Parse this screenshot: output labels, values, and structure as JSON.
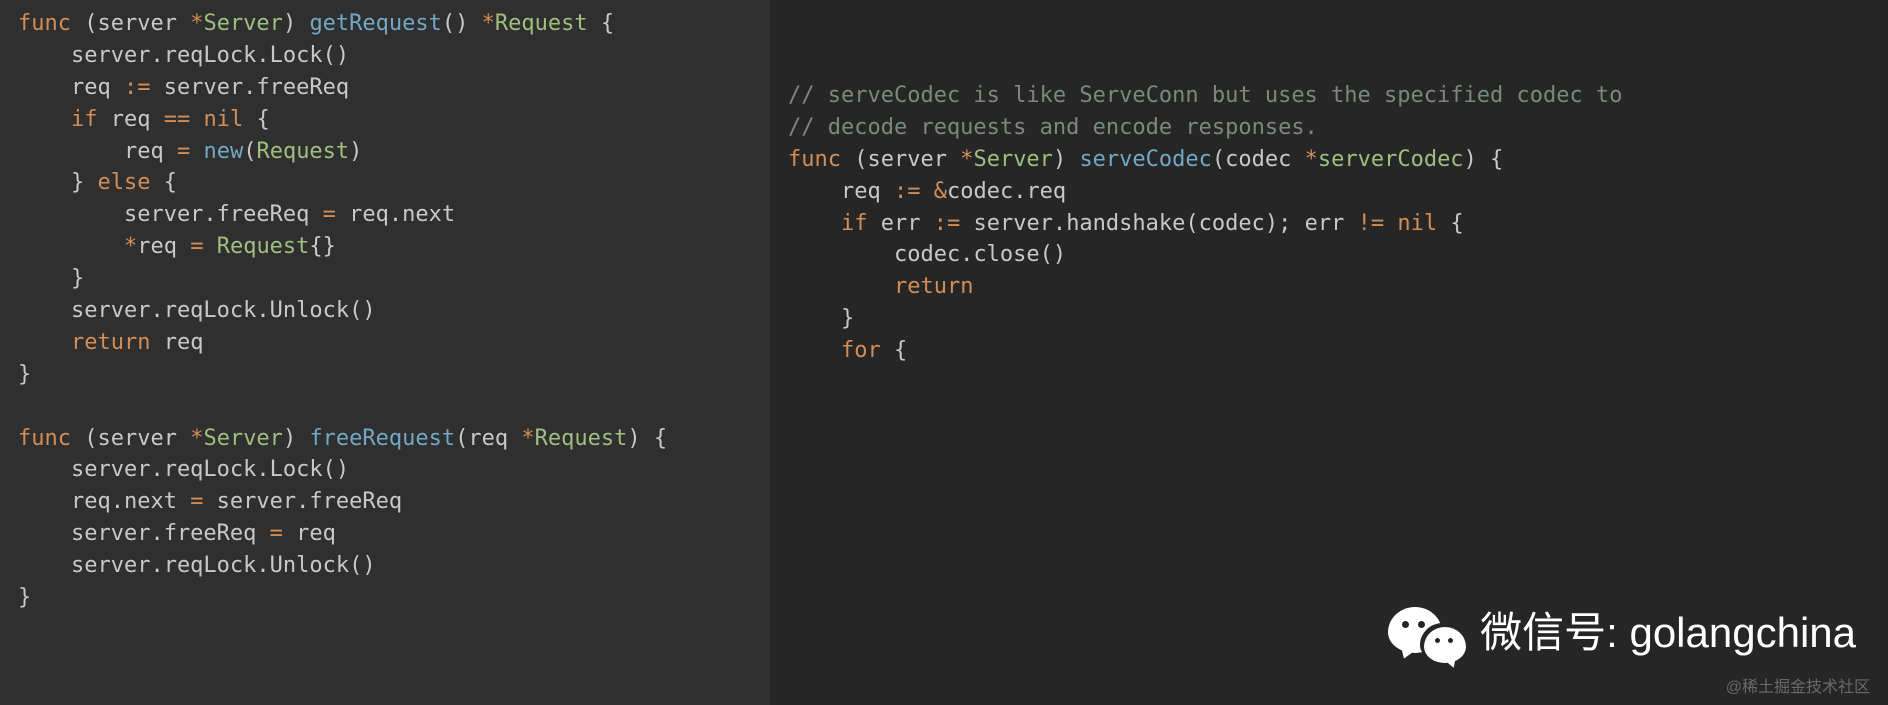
{
  "left": {
    "l1a": "func",
    "l1b": " (server ",
    "l1c": "*",
    "l1d": "Server",
    "l1e": ") ",
    "l1f": "getRequest",
    "l1g": "() ",
    "l1h": "*",
    "l1i": "Request",
    "l1j": " {",
    "l2a": "    server.reqLock.",
    "l2b": "Lock",
    "l2c": "()",
    "l3a": "    req ",
    "l3b": ":=",
    "l3c": " server.freeReq",
    "l4a": "    ",
    "l4b": "if",
    "l4c": " req ",
    "l4d": "==",
    "l4e": " ",
    "l4f": "nil",
    "l4g": " {",
    "l5a": "        req ",
    "l5b": "=",
    "l5c": " ",
    "l5d": "new",
    "l5e": "(",
    "l5f": "Request",
    "l5g": ")",
    "l6a": "    } ",
    "l6b": "else",
    "l6c": " {",
    "l7a": "        server.freeReq ",
    "l7b": "=",
    "l7c": " req.next",
    "l8a": "        ",
    "l8b": "*",
    "l8c": "req ",
    "l8d": "=",
    "l8e": " ",
    "l8f": "Request",
    "l8g": "{}",
    "l9a": "    }",
    "l10a": "    server.reqLock.",
    "l10b": "Unlock",
    "l10c": "()",
    "l11a": "    ",
    "l11b": "return",
    "l11c": " req",
    "l12a": "}",
    "blank": "",
    "l14a": "func",
    "l14b": " (server ",
    "l14c": "*",
    "l14d": "Server",
    "l14e": ") ",
    "l14f": "freeRequest",
    "l14g": "(req ",
    "l14h": "*",
    "l14i": "Request",
    "l14j": ") {",
    "l15a": "    server.reqLock.",
    "l15b": "Lock",
    "l15c": "()",
    "l16a": "    req.next ",
    "l16b": "=",
    "l16c": " server.freeReq",
    "l17a": "    server.freeReq ",
    "l17b": "=",
    "l17c": " req",
    "l18a": "    server.reqLock.",
    "l18b": "Unlock",
    "l18c": "()",
    "l19a": "}"
  },
  "right": {
    "c1": "// serveCodec is like ServeConn but uses the specified codec to",
    "c2": "// decode requests and encode responses.",
    "r1a": "func",
    "r1b": " (server ",
    "r1c": "*",
    "r1d": "Server",
    "r1e": ") ",
    "r1f": "serveCodec",
    "r1g": "(codec ",
    "r1h": "*",
    "r1i": "serverCodec",
    "r1j": ") {",
    "r2a": "    req ",
    "r2b": ":=",
    "r2c": " ",
    "r2d": "&",
    "r2e": "codec.req",
    "r3a": "    ",
    "r3b": "if",
    "r3c": " err ",
    "r3d": ":=",
    "r3e": " server.",
    "r3f": "handshake",
    "r3g": "(codec); err ",
    "r3h": "!=",
    "r3i": " ",
    "r3j": "nil",
    "r3k": " {",
    "r4a": "        codec.",
    "r4b": "close",
    "r4c": "()",
    "r5a": "        ",
    "r5b": "return",
    "r6a": "    }",
    "r7a": "    ",
    "r7b": "for",
    "r7c": " {"
  },
  "watermark": {
    "label": "微信号: golangchina"
  },
  "attribution": "@稀土掘金技术社区"
}
